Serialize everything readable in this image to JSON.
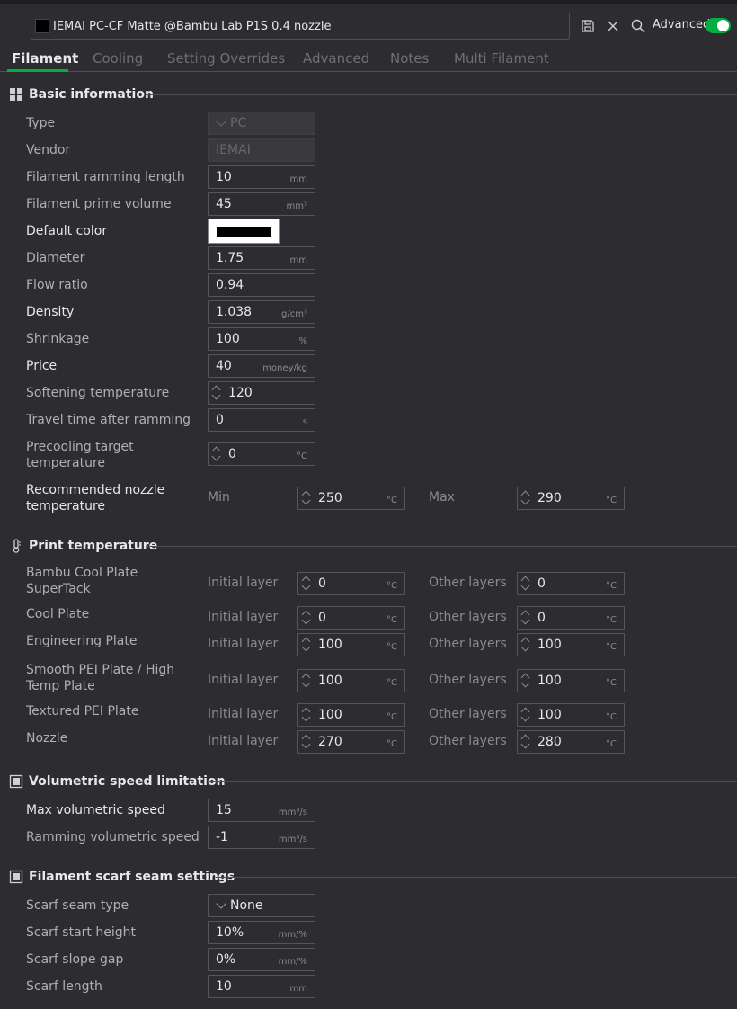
{
  "header": {
    "preset_name": "IEMAI PC-CF Matte @Bambu Lab P1S 0.4 nozzle",
    "advanced_label": "Advanced",
    "advanced_on": true,
    "accent_color": "#00ae42"
  },
  "tabs": [
    {
      "label": "Filament",
      "active": true
    },
    {
      "label": "Cooling",
      "active": false
    },
    {
      "label": "Setting Overrides",
      "active": false
    },
    {
      "label": "Advanced",
      "active": false
    },
    {
      "label": "Notes",
      "active": false
    },
    {
      "label": "Multi Filament",
      "active": false
    }
  ],
  "basic": {
    "title": "Basic information",
    "type": {
      "label": "Type",
      "value": "PC"
    },
    "vendor": {
      "label": "Vendor",
      "value": "IEMAI"
    },
    "ramming_length": {
      "label": "Filament ramming length",
      "value": "10",
      "unit": "mm"
    },
    "prime_volume": {
      "label": "Filament prime volume",
      "value": "45",
      "unit": "mm³"
    },
    "default_color": {
      "label": "Default color",
      "value": "#000000"
    },
    "diameter": {
      "label": "Diameter",
      "value": "1.75",
      "unit": "mm"
    },
    "flow_ratio": {
      "label": "Flow ratio",
      "value": "0.94"
    },
    "density": {
      "label": "Density",
      "value": "1.038",
      "unit": "g/cm³"
    },
    "shrinkage": {
      "label": "Shrinkage",
      "value": "100",
      "unit": "%"
    },
    "price": {
      "label": "Price",
      "value": "40",
      "unit": "money/kg"
    },
    "softening": {
      "label": "Softening temperature",
      "value": "120"
    },
    "travel_time": {
      "label": "Travel time after ramming",
      "value": "0",
      "unit": "s"
    },
    "precooling": {
      "label_1": "Precooling target",
      "label_2": "temperature",
      "value": "0",
      "unit": "°C"
    },
    "nozzle_rec": {
      "label_1": "Recommended nozzle",
      "label_2": "temperature",
      "min_label": "Min",
      "min": "250",
      "max_label": "Max",
      "max": "290",
      "unit": "°C"
    }
  },
  "print_temp": {
    "title": "Print temperature",
    "initial_label": "Initial layer",
    "other_label": "Other layers",
    "unit": "°C",
    "rows": [
      {
        "label_1": "Bambu Cool Plate",
        "label_2": "SuperTack",
        "initial": "0",
        "other": "0"
      },
      {
        "label_1": "Cool Plate",
        "label_2": "",
        "initial": "0",
        "other": "0"
      },
      {
        "label_1": "Engineering Plate",
        "label_2": "",
        "initial": "100",
        "other": "100"
      },
      {
        "label_1": "Smooth PEI Plate / High",
        "label_2": "Temp Plate",
        "initial": "100",
        "other": "100"
      },
      {
        "label_1": "Textured PEI Plate",
        "label_2": "",
        "initial": "100",
        "other": "100"
      },
      {
        "label_1": "Nozzle",
        "label_2": "",
        "initial": "270",
        "other": "280"
      }
    ]
  },
  "volumetric": {
    "title": "Volumetric speed limitation",
    "max": {
      "label": "Max volumetric speed",
      "value": "15",
      "unit": "mm³/s"
    },
    "ramming": {
      "label": "Ramming volumetric speed",
      "value": "-1",
      "unit": "mm³/s"
    }
  },
  "scarf": {
    "title": "Filament scarf seam settings",
    "type": {
      "label": "Scarf seam type",
      "value": "None"
    },
    "start_height": {
      "label": "Scarf start height",
      "value": "10%",
      "unit": "mm/%"
    },
    "slope_gap": {
      "label": "Scarf slope gap",
      "value": "0%",
      "unit": "mm/%"
    },
    "length": {
      "label": "Scarf length",
      "value": "10",
      "unit": "mm"
    }
  }
}
